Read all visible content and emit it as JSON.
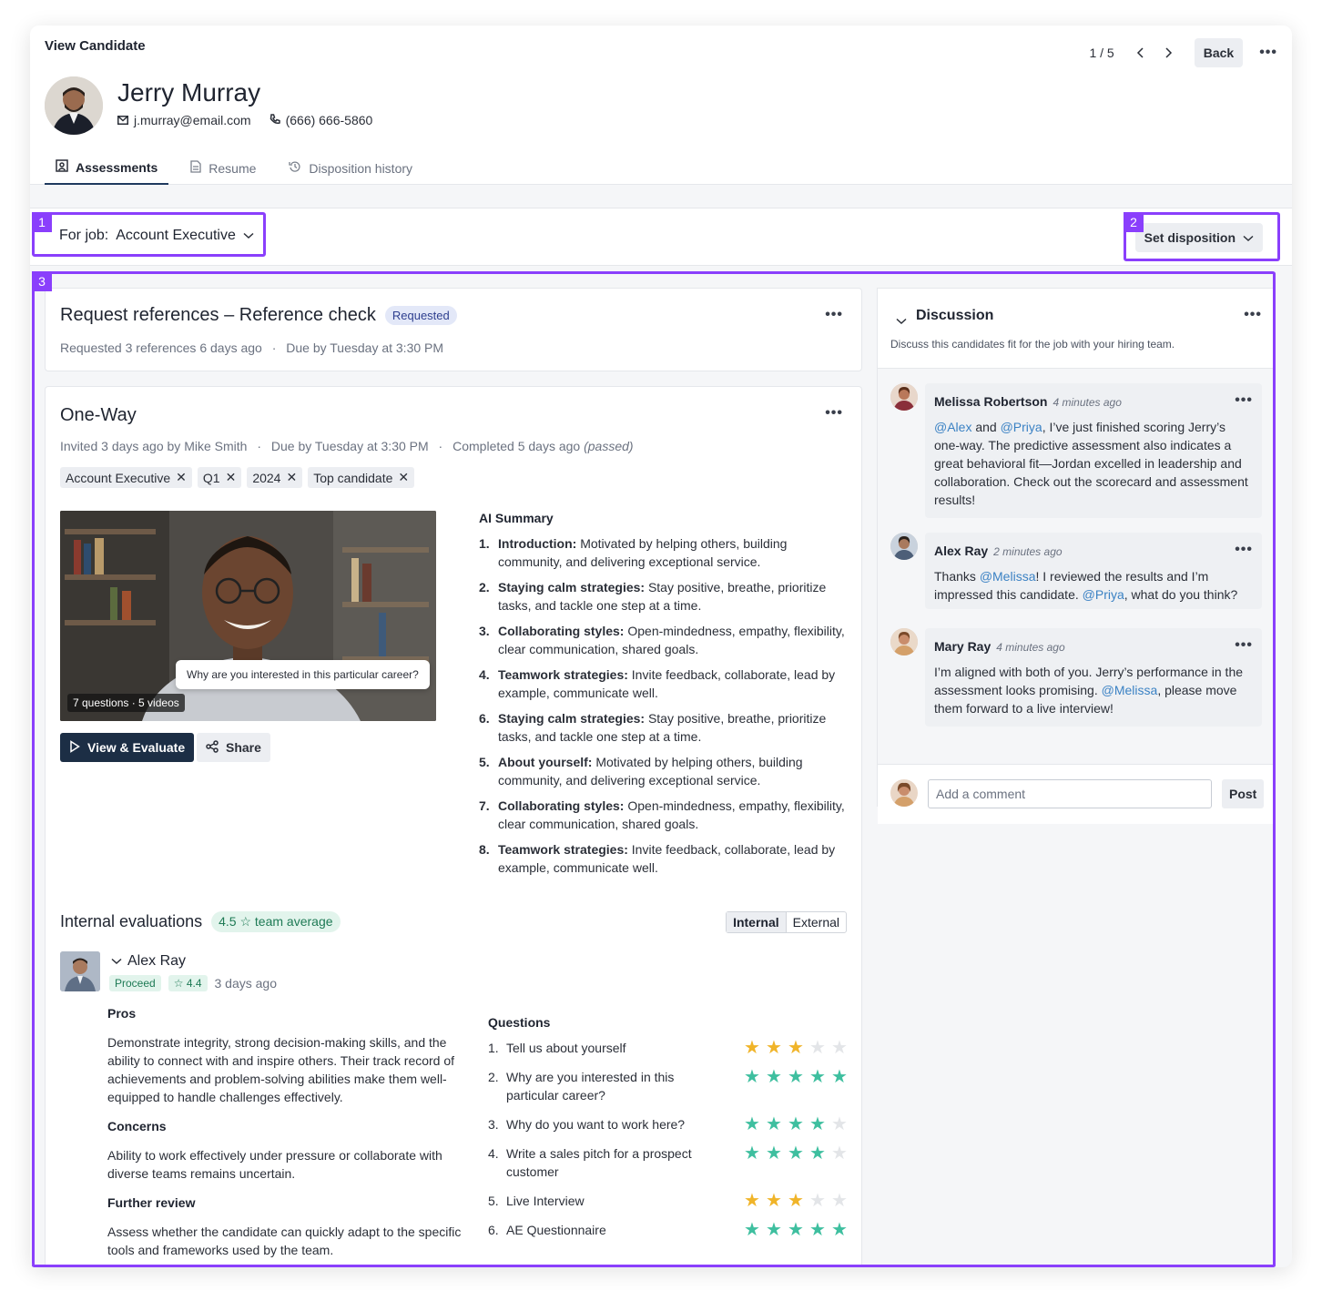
{
  "header": {
    "title": "View Candidate",
    "pager": "1 / 5",
    "back_label": "Back",
    "more": "•••"
  },
  "candidate": {
    "name": "Jerry Murray",
    "email": "j.murray@email.com",
    "phone": "(666) 666-5860"
  },
  "tabs": [
    "Assessments",
    "Resume",
    "Disposition history"
  ],
  "job": {
    "prefix": "For job:",
    "value": "Account Executive"
  },
  "disposition": {
    "label": "Set disposition"
  },
  "highlights": [
    "1",
    "2",
    "3"
  ],
  "reference": {
    "title": "Request references – Reference check",
    "badge": "Requested",
    "meta1": "Requested 3 references 6 days ago",
    "meta2": "Due by Tuesday at 3:30 PM"
  },
  "oneway": {
    "title": "One-Way",
    "meta1": "Invited 3 days ago by Mike Smith",
    "meta2": "Due by Tuesday at 3:30 PM",
    "meta3": "Completed 5 days ago",
    "meta3_note": "(passed)",
    "tags": [
      "Account Executive",
      "Q1",
      "2024",
      "Top candidate"
    ],
    "video_badge": "7 questions · 5 videos",
    "question_bubble": "Why are you interested in this particular career?",
    "view_label": "View & Evaluate",
    "share_label": "Share",
    "ai_title": "AI Summary",
    "ai_items": [
      {
        "num": "1.",
        "bold": "Introduction:",
        "text": " Motivated by helping others, building community, and delivering  exceptional service."
      },
      {
        "num": "2.",
        "bold": "Staying calm strategies:",
        "text": " Stay positive, breathe, prioritize tasks, and tackle one step at a time."
      },
      {
        "num": "3.",
        "bold": "Collaborating styles:",
        "text": " Open-mindedness, empathy, flexibility, clear communication, shared goals."
      },
      {
        "num": "4.",
        "bold": "Teamwork strategies:",
        "text": " Invite feedback, collaborate, lead by example, communicate well."
      },
      {
        "num": "6.",
        "bold": "Staying calm strategies:",
        "text": " Stay positive, breathe, prioritize tasks, and tackle one step at a time."
      },
      {
        "num": "5.",
        "bold": "About yourself:",
        "text": " Motivated by helping others, building community, and delivering  exceptional service."
      },
      {
        "num": "7.",
        "bold": "Collaborating styles:",
        "text": " Open-mindedness, empathy, flexibility, clear communication, shared goals."
      },
      {
        "num": "8.",
        "bold": "Teamwork strategies:",
        "text": " Invite feedback, collaborate, lead by example, communicate well."
      }
    ]
  },
  "evaluations": {
    "title": "Internal evaluations",
    "team_avg": "4.5",
    "team_avg_label": "team average",
    "toggle": [
      "Internal",
      "External"
    ],
    "evaluator": {
      "name": "Alex Ray",
      "status": "Proceed",
      "score": "4.4",
      "when": "3 days ago"
    },
    "pros_title": "Pros",
    "pros": "Demonstrate integrity, strong decision-making skills, and the ability to connect with and inspire others. Their track record of achievements and problem-solving abilities make them well-equipped to handle challenges effectively.",
    "concerns_title": "Concerns",
    "concerns": "Ability to work effectively under pressure or collaborate with diverse teams remains uncertain.",
    "further_title": "Further review",
    "further": "Assess whether the candidate can quickly adapt to the specific tools and frameworks used by the team.",
    "questions_title": "Questions",
    "questions": [
      {
        "num": "1.",
        "text": "Tell us about yourself",
        "rating": 3
      },
      {
        "num": "2.",
        "text": "Why are you interested in this particular career?",
        "rating": 5
      },
      {
        "num": "3.",
        "text": "Why do you want to work here?",
        "rating": 4
      },
      {
        "num": "4.",
        "text": "Write a sales pitch for a prospect customer",
        "rating": 4
      },
      {
        "num": "5.",
        "text": "Live Interview",
        "rating": 3
      },
      {
        "num": "6.",
        "text": "AE Questionnaire",
        "rating": 5
      }
    ],
    "colors": {
      "low": "#f0b429",
      "high": "#3ebf9f",
      "empty": "#e3e5e8"
    }
  },
  "discussion": {
    "title": "Discussion",
    "subtitle": "Discuss this candidates fit for the job with your hiring team.",
    "messages": [
      {
        "author": "Melissa Robertson",
        "time": "4 minutes ago",
        "parts": [
          [
            "m",
            "@Alex"
          ],
          [
            "t",
            " and "
          ],
          [
            "m",
            "@Priya"
          ],
          [
            "t",
            ", I’ve just finished scoring Jerry’s one-way. The predictive assessment also indicates a great behavioral fit—Jordan excelled in leadership and collaboration. Check out the scorecard and assessment results!"
          ]
        ]
      },
      {
        "author": "Alex Ray",
        "time": "2 minutes ago",
        "parts": [
          [
            "t",
            "Thanks "
          ],
          [
            "m",
            "@Melissa"
          ],
          [
            "t",
            "! I reviewed the results and I’m impressed this candidate. "
          ],
          [
            "m",
            "@Priya"
          ],
          [
            "t",
            ", what do you think?"
          ]
        ]
      },
      {
        "author": "Mary Ray",
        "time": "4 minutes ago",
        "parts": [
          [
            "t",
            "I’m aligned with both of you. Jerry’s performance in the assessment looks promising. "
          ],
          [
            "m",
            "@Melissa"
          ],
          [
            "t",
            ", please move them forward to a live interview!"
          ]
        ]
      }
    ],
    "comment_placeholder": "Add a comment",
    "post_label": "Post"
  },
  "icons": [
    "mail-icon",
    "phone-icon",
    "chevron-left-icon",
    "chevron-right-icon",
    "more-icon",
    "assessment-icon",
    "resume-icon",
    "history-icon",
    "chevron-down-icon",
    "play-icon",
    "share-icon",
    "star-icon",
    "close-icon"
  ]
}
